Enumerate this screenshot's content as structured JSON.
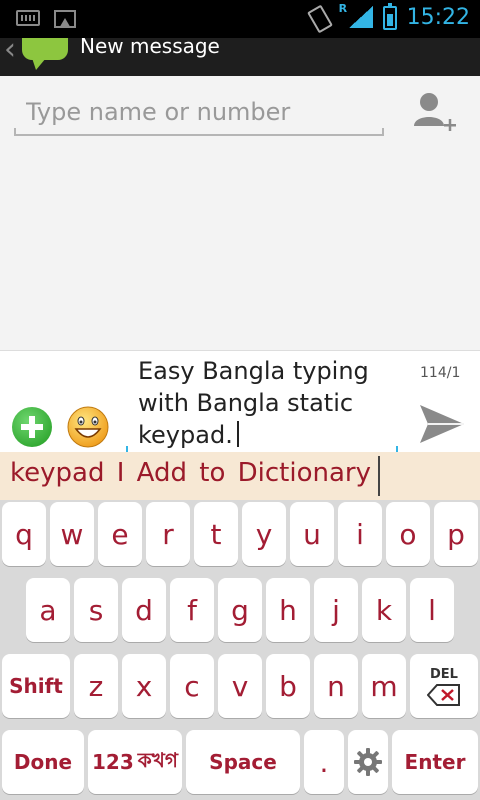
{
  "status_bar": {
    "network_badge": "R",
    "time": "15:22"
  },
  "action_bar": {
    "title": "New message"
  },
  "recipient": {
    "placeholder": "Type name or number"
  },
  "compose": {
    "message_text": "Easy Bangla typing with Bangla static keypad.",
    "counter": "114/1"
  },
  "suggestion": {
    "text": "keypad I Add to Dictionary"
  },
  "keyboard": {
    "row1": [
      "q",
      "w",
      "e",
      "r",
      "t",
      "y",
      "u",
      "i",
      "o",
      "p"
    ],
    "row2": [
      "a",
      "s",
      "d",
      "f",
      "g",
      "h",
      "j",
      "k",
      "l"
    ],
    "row3": [
      "z",
      "x",
      "c",
      "v",
      "b",
      "n",
      "m"
    ],
    "shift_label": "Shift",
    "del_label": "DEL",
    "done_label": "Done",
    "num_label": "123",
    "bangla_label": "কখগ",
    "space_label": "Space",
    "period_label": ".",
    "enter_label": "Enter"
  },
  "colors": {
    "key_text": "#a31d34",
    "accent": "#33b5e5",
    "suggest_bg": "#f7e8d4"
  }
}
